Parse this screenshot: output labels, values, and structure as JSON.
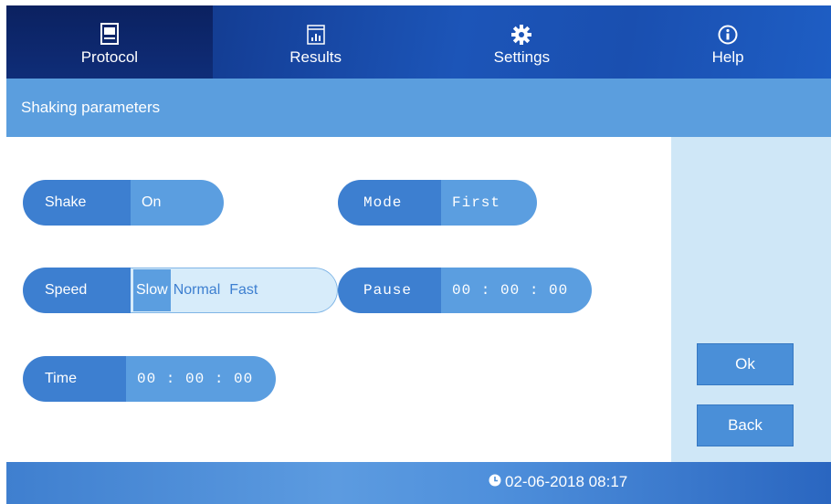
{
  "nav": {
    "tabs": [
      {
        "label": "Protocol",
        "icon": "monitor-icon",
        "active": true
      },
      {
        "label": "Results",
        "icon": "bar-chart-icon",
        "active": false
      },
      {
        "label": "Settings",
        "icon": "gear-icon",
        "active": false
      },
      {
        "label": "Help",
        "icon": "info-icon",
        "active": false
      }
    ]
  },
  "page": {
    "title": "Shaking parameters"
  },
  "params": {
    "shake": {
      "label": "Shake",
      "value": "On"
    },
    "mode": {
      "label": "Mode",
      "value": "First"
    },
    "speed": {
      "label": "Speed",
      "options": [
        "Slow",
        "Normal",
        "Fast"
      ],
      "selected": "Slow"
    },
    "pause": {
      "label": "Pause",
      "value": "00 : 00 : 00"
    },
    "time": {
      "label": "Time",
      "value": "00 : 00 : 00"
    }
  },
  "actions": {
    "ok_label": "Ok",
    "back_label": "Back"
  },
  "status": {
    "datetime": "02-06-2018 08:17",
    "icon": "clock-icon"
  },
  "colors": {
    "accent": "#3d7fd0",
    "nav_bg": "#15419a",
    "title_bar": "#5b9ede",
    "side_panel": "#cfe7f7"
  }
}
